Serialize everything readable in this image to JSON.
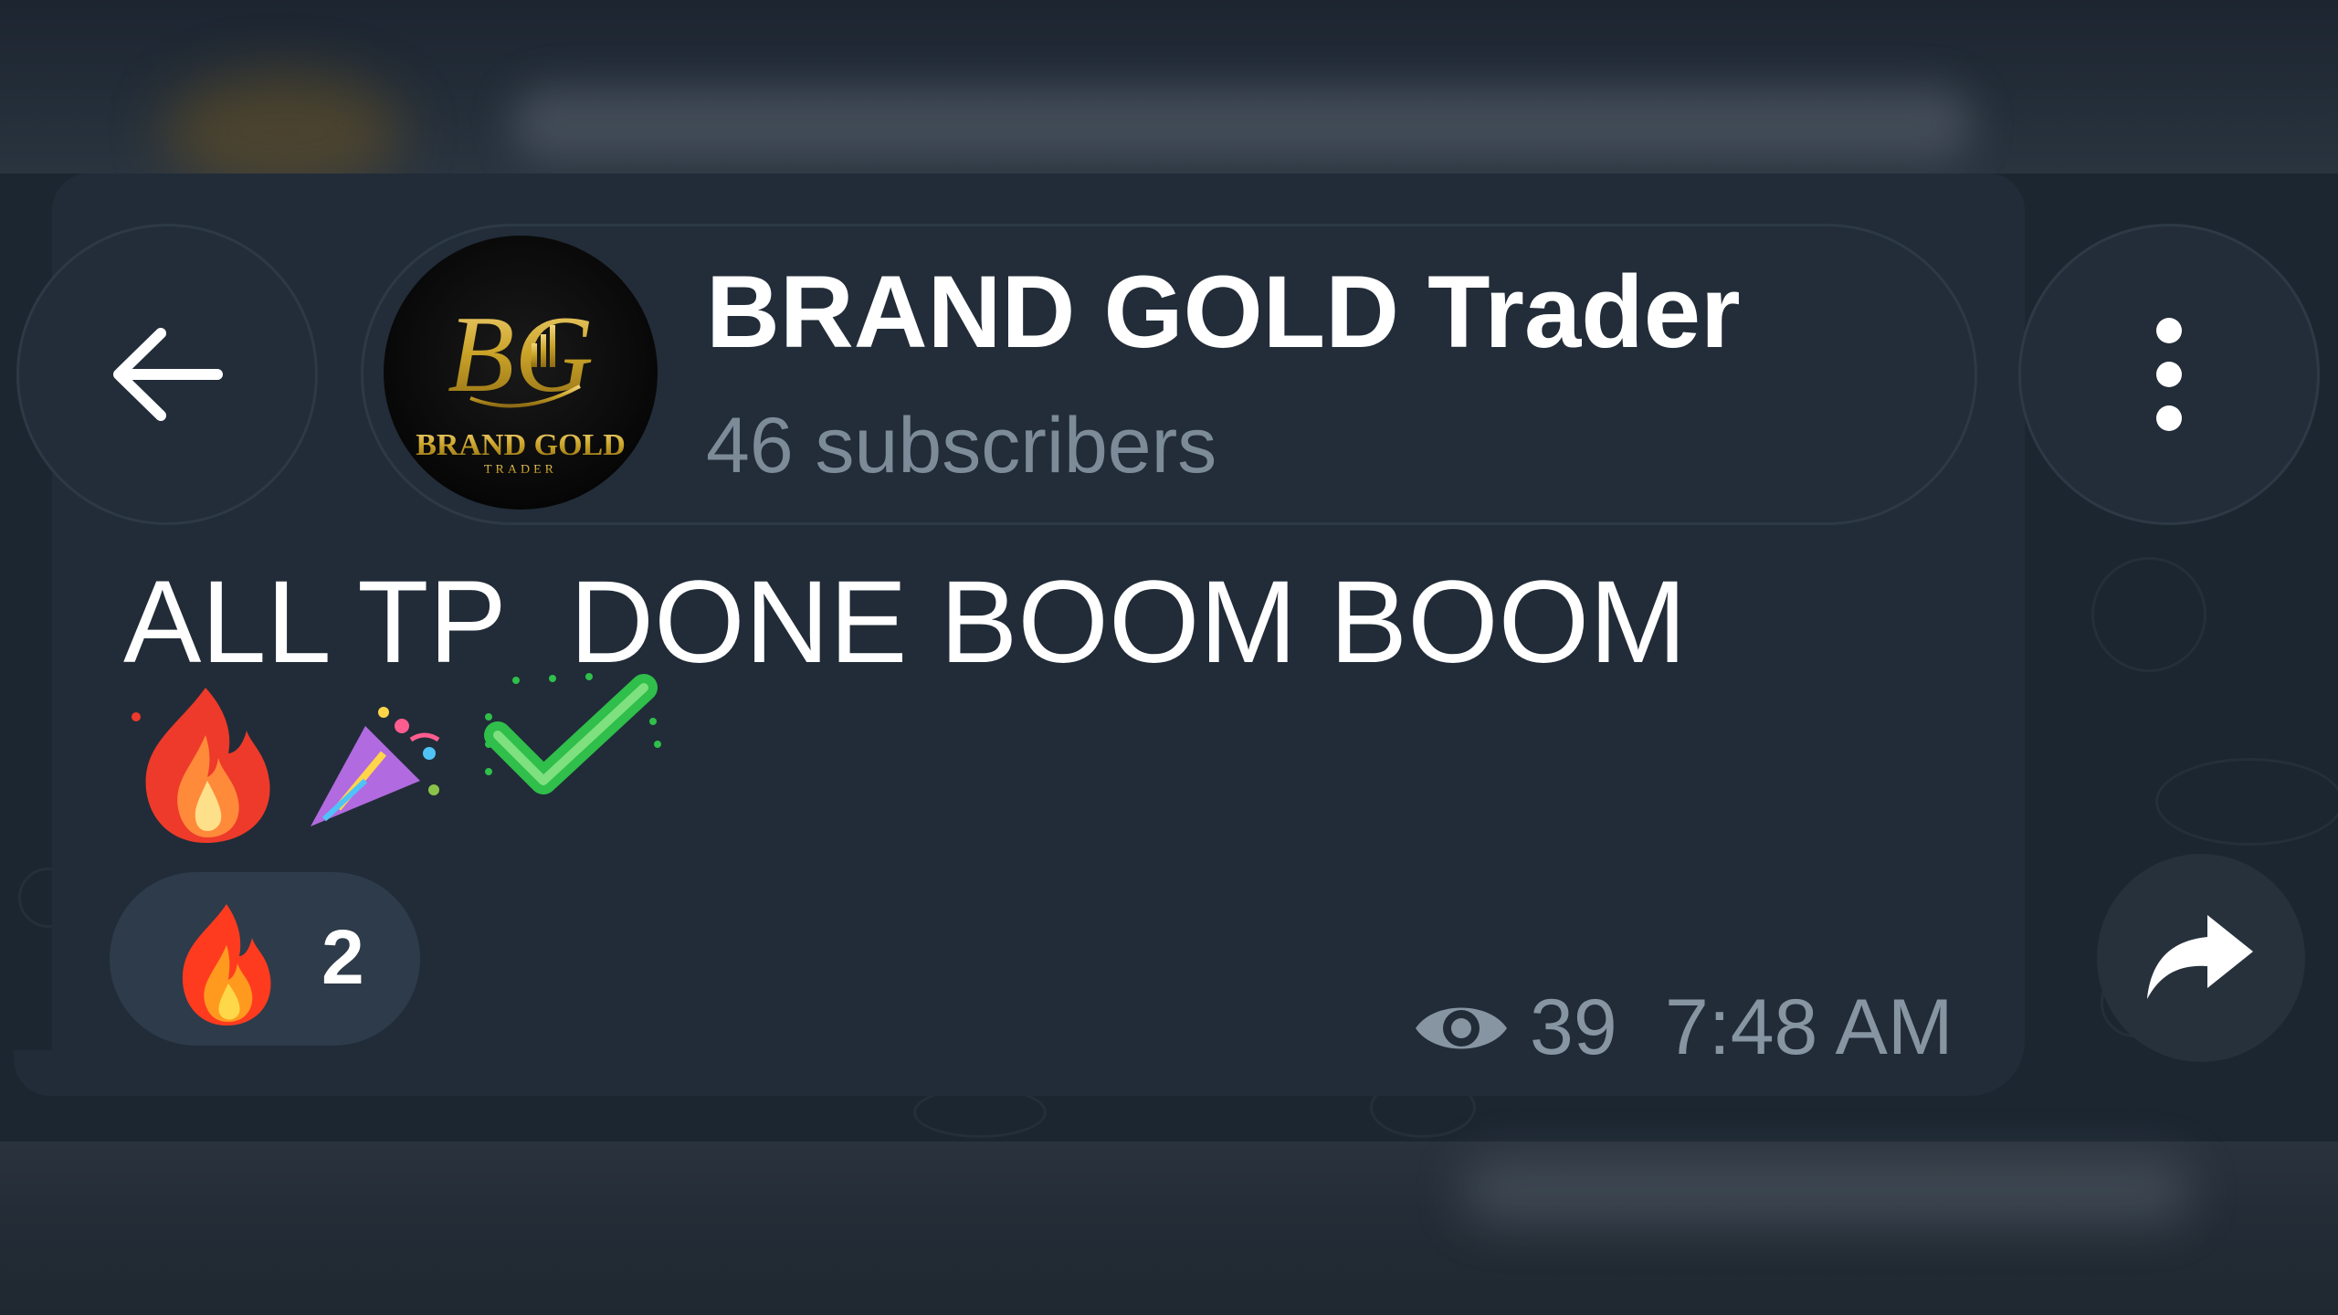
{
  "header": {
    "back_icon": "arrow-left-icon",
    "channel_name": "BRAND GOLD Trader",
    "subscribers": "46 subscribers",
    "avatar_logo_text": "BRAND GOLD",
    "avatar_logo_subtext": "TRADER",
    "avatar_monogram": "BG",
    "menu_icon": "more-vertical-icon"
  },
  "message": {
    "text": "ALL TP  DONE BOOM BOOM",
    "emojis": [
      "fire-emoji",
      "confetti-emoji",
      "check-mark-emoji"
    ],
    "reaction": {
      "icon": "fire-emoji",
      "count": "2"
    },
    "views": "39",
    "time": "7:48 AM",
    "views_icon": "eye-icon",
    "forward_icon": "share-arrow-icon"
  },
  "colors": {
    "accent_gold": "#c9a227",
    "bubble": "#212c38",
    "reaction_bg": "#2d3b4a",
    "meta_text": "#8795a3",
    "subtitle_text": "#7d8b99"
  }
}
